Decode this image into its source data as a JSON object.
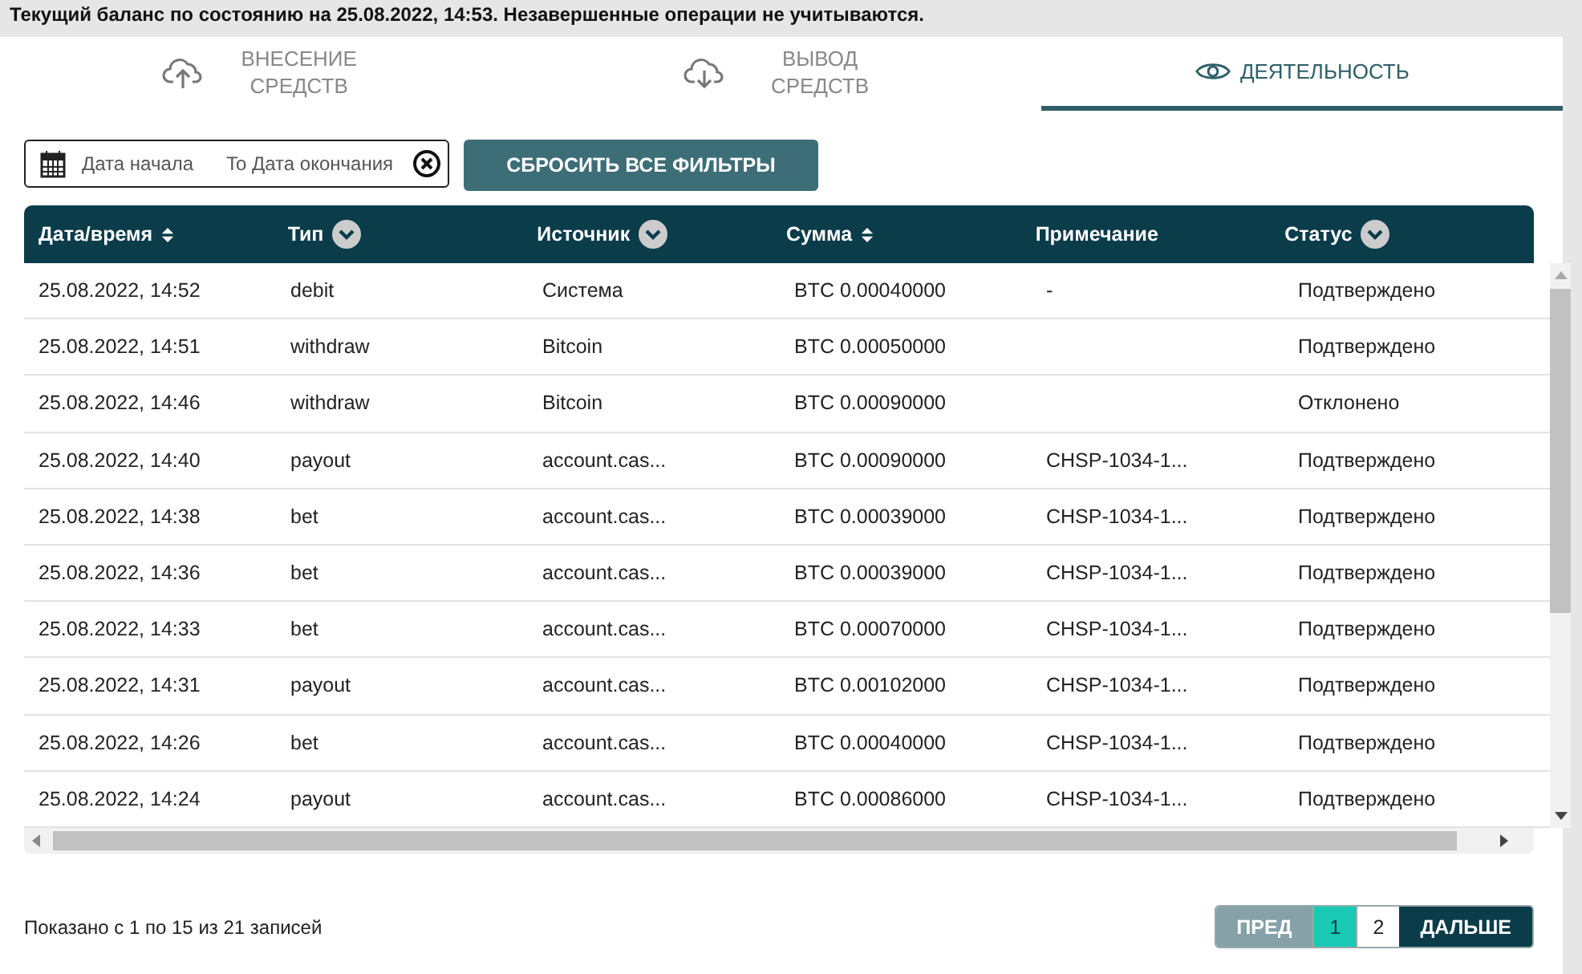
{
  "notice": "Текущий баланс по состоянию на 25.08.2022, 14:53. Незавершенные операции не учитываются.",
  "tabs": [
    {
      "label": "ВНЕСЕНИЕ СРЕДСТВ",
      "kind": "upload",
      "selected": false
    },
    {
      "label": "ВЫВОД СРЕДСТВ",
      "kind": "download",
      "selected": false
    },
    {
      "label": "ДЕЯТЕЛЬНОСТЬ",
      "kind": "eye",
      "selected": true
    }
  ],
  "date_filter": {
    "start_placeholder": "Дата начала",
    "end_placeholder": "To Дата окончания"
  },
  "reset_button": "СБРОСИТЬ ВСЕ ФИЛЬТРЫ",
  "table": {
    "columns": [
      {
        "label": "Дата/время",
        "sortable": true,
        "filterable": false
      },
      {
        "label": "Тип",
        "sortable": false,
        "filterable": true
      },
      {
        "label": "Источник",
        "sortable": false,
        "filterable": true
      },
      {
        "label": "Сумма",
        "sortable": true,
        "filterable": false
      },
      {
        "label": "Примечание",
        "sortable": false,
        "filterable": false
      },
      {
        "label": "Статус",
        "sortable": false,
        "filterable": true
      }
    ],
    "rows": [
      [
        "25.08.2022, 14:52",
        "debit",
        "Система",
        "BTC 0.00040000",
        "-",
        "Подтверждено"
      ],
      [
        "25.08.2022, 14:51",
        "withdraw",
        "Bitcoin",
        "BTC 0.00050000",
        "",
        "Подтверждено"
      ],
      [
        "25.08.2022, 14:46",
        "withdraw",
        "Bitcoin",
        "BTC 0.00090000",
        "",
        "Отклонено"
      ],
      [
        "25.08.2022, 14:40",
        "payout",
        "account.cas...",
        "BTC 0.00090000",
        "CHSP-1034-1...",
        "Подтверждено"
      ],
      [
        "25.08.2022, 14:38",
        "bet",
        "account.cas...",
        "BTC 0.00039000",
        "CHSP-1034-1...",
        "Подтверждено"
      ],
      [
        "25.08.2022, 14:36",
        "bet",
        "account.cas...",
        "BTC 0.00039000",
        "CHSP-1034-1...",
        "Подтверждено"
      ],
      [
        "25.08.2022, 14:33",
        "bet",
        "account.cas...",
        "BTC 0.00070000",
        "CHSP-1034-1...",
        "Подтверждено"
      ],
      [
        "25.08.2022, 14:31",
        "payout",
        "account.cas...",
        "BTC 0.00102000",
        "CHSP-1034-1...",
        "Подтверждено"
      ],
      [
        "25.08.2022, 14:26",
        "bet",
        "account.cas...",
        "BTC 0.00040000",
        "CHSP-1034-1...",
        "Подтверждено"
      ],
      [
        "25.08.2022, 14:24",
        "payout",
        "account.cas...",
        "BTC 0.00086000",
        "CHSP-1034-1...",
        "Подтверждено"
      ]
    ]
  },
  "summary": "Показано с 1 по 15 из 21 записей",
  "pagination": {
    "prev": {
      "label": "ПРЕД",
      "disabled": true
    },
    "pages": [
      {
        "label": "1",
        "selected": true
      },
      {
        "label": "2",
        "selected": false
      }
    ],
    "next": {
      "label": "ДАЛЬШЕ",
      "disabled": false
    }
  }
}
